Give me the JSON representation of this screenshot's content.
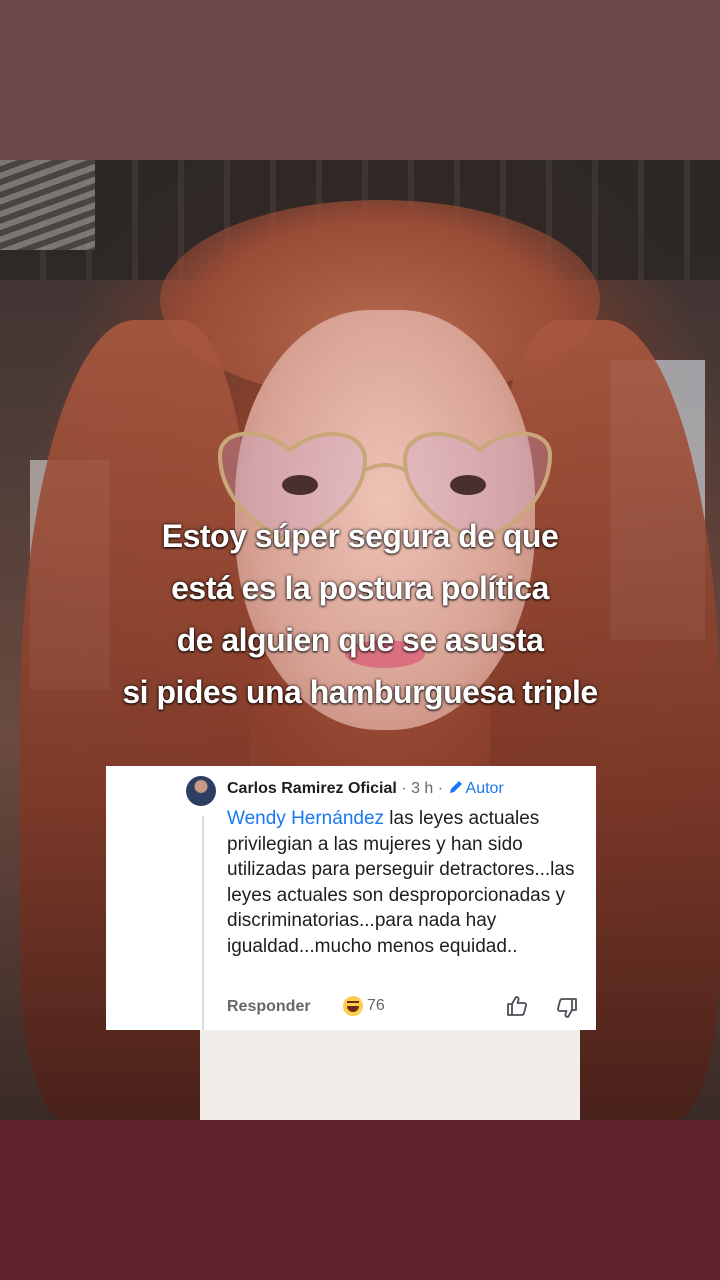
{
  "caption": {
    "lines": [
      "Estoy súper segura de que",
      "está es la postura política",
      "de alguien que se asusta",
      "si pides una hamburguesa triple"
    ]
  },
  "comment": {
    "author": "Carlos Ramirez Oficial",
    "time_meta": " · 3 h · ",
    "author_badge": "Autor",
    "mention": "Wendy Hernández",
    "text": " las leyes actuales privilegian a las mujeres y han sido utilizadas para perseguir detractores...las leyes actuales son desproporcionadas y discriminatorias...para nada hay igualdad...mucho menos equidad..",
    "reply_label": "Responder",
    "reaction_count": "76",
    "reaction_icon": "laughing-emoji-icon"
  },
  "colors": {
    "mention_blue": "#1877f2",
    "top_band": "#6b464a",
    "bottom_band": "#60242c"
  }
}
